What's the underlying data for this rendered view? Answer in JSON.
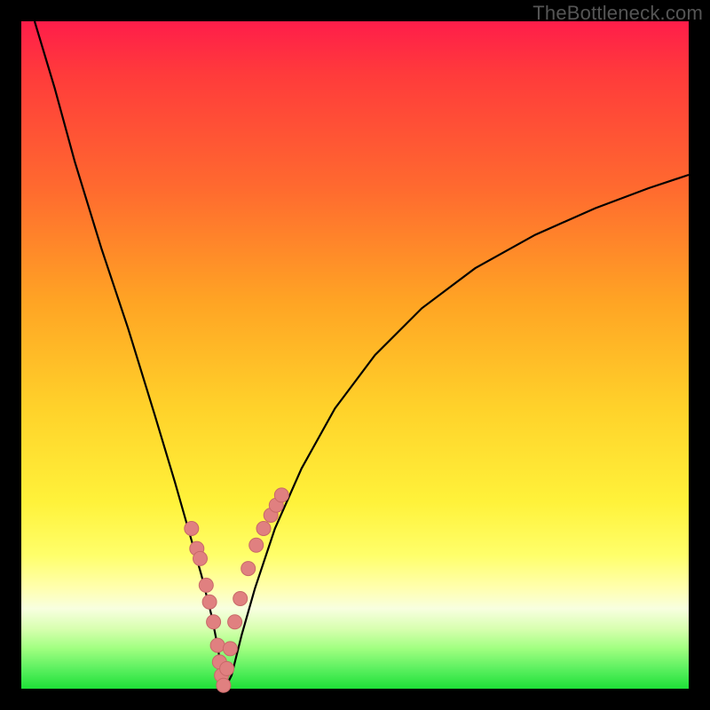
{
  "watermark": "TheBottleneck.com",
  "colors": {
    "frame": "#000000",
    "curve": "#000000",
    "marker_fill": "#e08080",
    "marker_stroke": "#c86868"
  },
  "chart_data": {
    "type": "line",
    "title": "",
    "xlabel": "",
    "ylabel": "",
    "xlim": [
      0,
      100
    ],
    "ylim": [
      0,
      100
    ],
    "grid": false,
    "legend": false,
    "series_curve": {
      "name": "bottleneck-curve",
      "comment": "V-shaped bottleneck curve. x in 0..100, y=0 bottom (green) .. 100 top (red). Values estimated from pixel positions.",
      "x": [
        2,
        5,
        8,
        12,
        16,
        20,
        23,
        25,
        27,
        28.5,
        29.5,
        30,
        30.5,
        31.5,
        33,
        35,
        38,
        42,
        47,
        53,
        60,
        68,
        77,
        86,
        94,
        100
      ],
      "y": [
        100,
        90,
        79,
        66,
        54,
        41,
        31,
        24,
        17,
        11,
        6,
        2,
        0,
        2,
        8,
        15,
        24,
        33,
        42,
        50,
        57,
        63,
        68,
        72,
        75,
        77
      ]
    },
    "series_markers": {
      "name": "data-points",
      "comment": "Salmon dot markers clustered on both arms near the vertex.",
      "x": [
        25.5,
        26.3,
        26.8,
        27.7,
        28.2,
        28.8,
        29.4,
        29.7,
        30.0,
        30.3,
        30.8,
        31.3,
        32.0,
        32.8,
        34.0,
        35.2,
        36.3,
        37.4,
        38.2,
        39.0
      ],
      "y": [
        24.0,
        21.0,
        19.5,
        15.5,
        13.0,
        10.0,
        6.5,
        4.0,
        2.0,
        0.5,
        3.0,
        6.0,
        10.0,
        13.5,
        18.0,
        21.5,
        24.0,
        26.0,
        27.5,
        29.0
      ]
    },
    "marker_radius_px": 8
  }
}
